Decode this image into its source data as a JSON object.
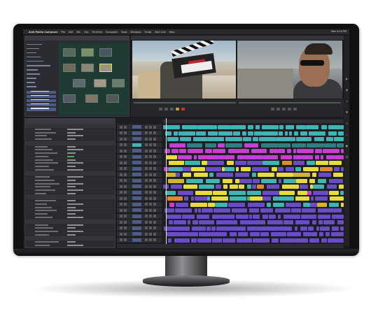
{
  "app": {
    "name": "Avid Media Composer",
    "menu": [
      "File",
      "Edit",
      "Bin",
      "Clip",
      "Timeline",
      "Composer",
      "Tools",
      "Windows",
      "Script",
      "Avid Link",
      "Help"
    ],
    "clock": "Mon 8:10 PM"
  },
  "colors": {
    "accent": "#4c5d88",
    "timecode": "#6fdc6f",
    "clip_yellow": "#e8dc38",
    "clip_orange": "#e08a2c",
    "clip_purple": "#6a4cc9",
    "clip_magenta": "#c53fd1",
    "clip_teal": "#3fb5b3"
  },
  "icons": {
    "palette": [
      "select-icon",
      "trim-icon",
      "link-icon",
      "marker-icon",
      "effects-icon",
      "audio-icon",
      "color-icon",
      "settings-icon"
    ]
  }
}
